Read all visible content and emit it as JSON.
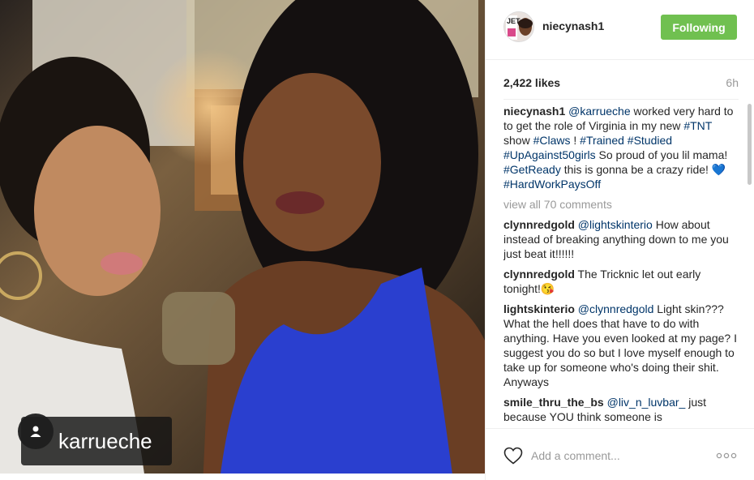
{
  "post": {
    "username": "niecynash1",
    "follow_label": "Following",
    "likes": "2,422 likes",
    "time": "6h",
    "tag_username": "karrueche",
    "caption": {
      "user": "niecynash1",
      "parts": [
        {
          "text": "@karrueche",
          "link": true
        },
        {
          "text": " worked very hard to to get the role of Virginia in my new ",
          "link": false
        },
        {
          "text": "#TNT",
          "link": true
        },
        {
          "text": " show ",
          "link": false
        },
        {
          "text": "#Claws",
          "link": true
        },
        {
          "text": " ! ",
          "link": false
        },
        {
          "text": "#Trained",
          "link": true
        },
        {
          "text": " ",
          "link": false
        },
        {
          "text": "#Studied",
          "link": true
        },
        {
          "text": " ",
          "link": false
        },
        {
          "text": "#UpAgainst50girls",
          "link": true
        },
        {
          "text": " So proud of you lil mama! ",
          "link": false
        },
        {
          "text": "#GetReady",
          "link": true
        },
        {
          "text": " this is gonna be a crazy ride! 💙",
          "link": false
        },
        {
          "text": "#HardWorkPaysOff",
          "link": true
        }
      ]
    },
    "view_all": "view all 70 comments",
    "comments": [
      {
        "user": "clynnredgold",
        "parts": [
          {
            "text": " ",
            "link": false
          },
          {
            "text": "@lightskinterio",
            "link": true
          },
          {
            "text": " How about instead of breaking anything down to me you just beat it!!!!!!",
            "link": false
          }
        ]
      },
      {
        "user": "clynnredgold",
        "parts": [
          {
            "text": " The Tricknic let out early tonight!😘",
            "link": false
          }
        ]
      },
      {
        "user": "lightskinterio",
        "parts": [
          {
            "text": " ",
            "link": false
          },
          {
            "text": "@clynnredgold",
            "link": true
          },
          {
            "text": " Light skin??? What the hell does that have to do with anything. Have you even looked at my page? I suggest you do so but I love myself enough to take up for someone who's doing their shit. Anyways",
            "link": false
          }
        ]
      },
      {
        "user": "smile_thru_the_bs",
        "parts": [
          {
            "text": " ",
            "link": false
          },
          {
            "text": "@liv_n_luvbar_",
            "link": true
          },
          {
            "text": " just because YOU think someone is",
            "link": false
          }
        ]
      }
    ],
    "add_comment_placeholder": "Add a comment...",
    "icons": {
      "like": "heart-icon",
      "more": "more-options-icon",
      "tag": "user-tag-icon"
    },
    "colors": {
      "follow_button": "#70c050",
      "link": "#003569",
      "muted": "#999999"
    }
  }
}
